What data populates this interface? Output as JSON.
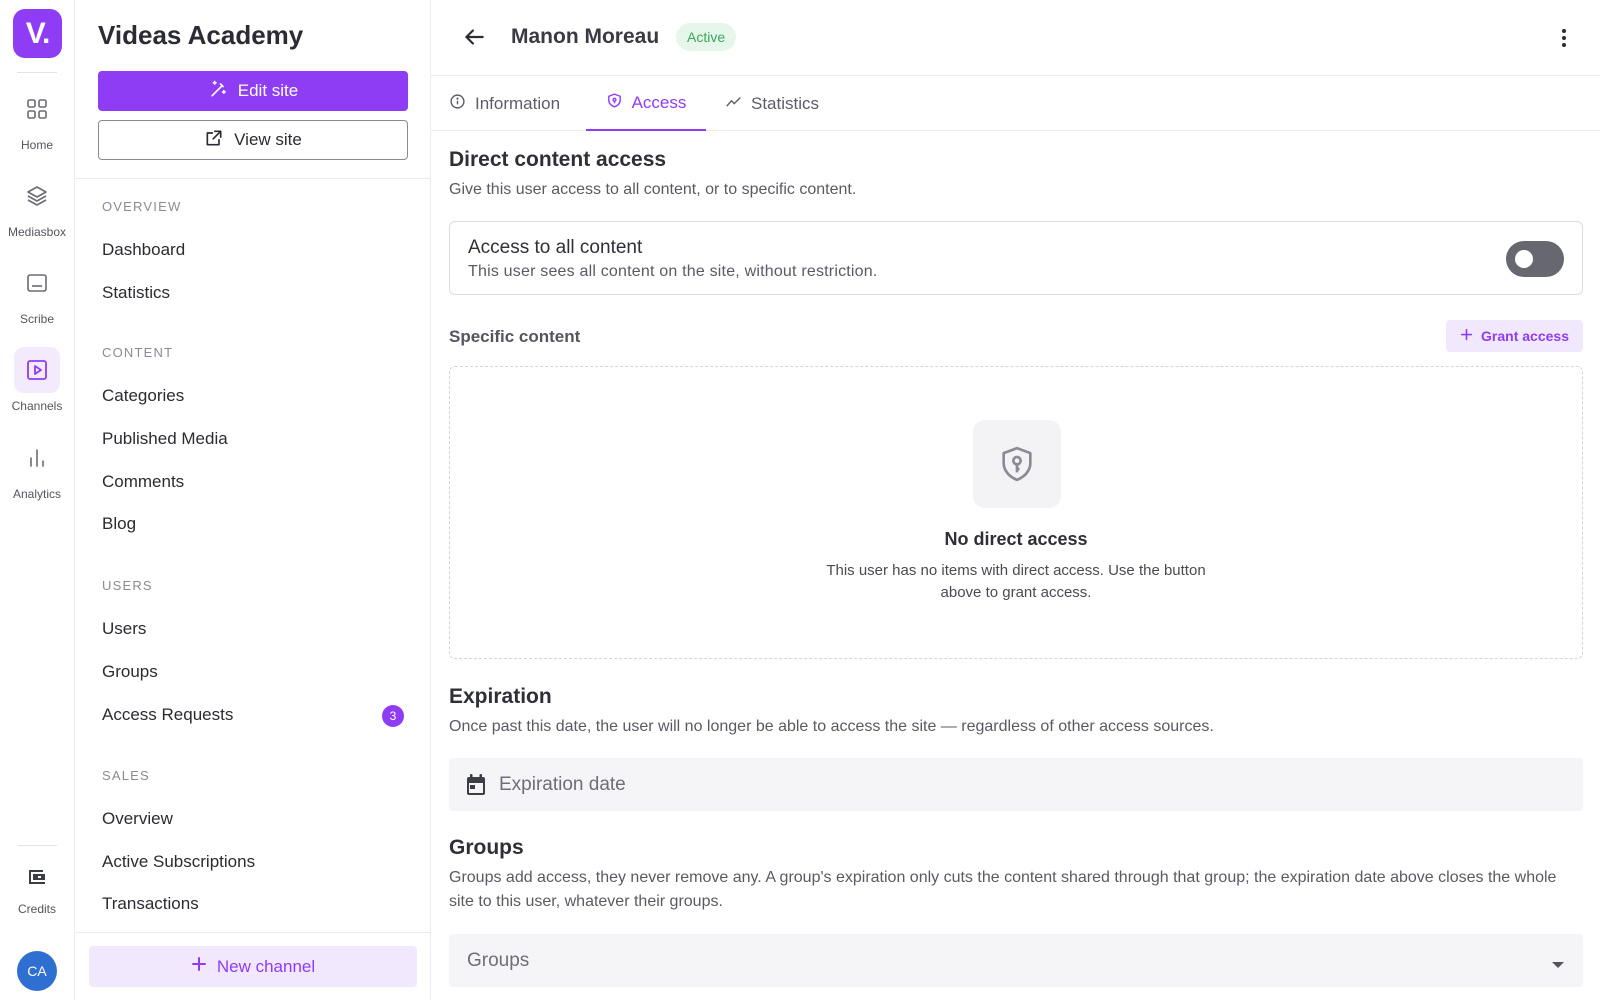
{
  "rail": {
    "logo": "V.",
    "items": [
      {
        "label": "Home",
        "icon": "grid-icon"
      },
      {
        "label": "Mediasbox",
        "icon": "layers-icon"
      },
      {
        "label": "Scribe",
        "icon": "subtitles-icon"
      },
      {
        "label": "Channels",
        "icon": "play-square-icon",
        "active": true
      },
      {
        "label": "Analytics",
        "icon": "bar-chart-icon"
      }
    ],
    "credits_label": "Credits",
    "avatar_initials": "CA"
  },
  "sidebar": {
    "site_name": "Videas Academy",
    "edit_site": "Edit site",
    "view_site": "View site",
    "sections": {
      "overview": "OVERVIEW",
      "content": "CONTENT",
      "users": "USERS",
      "sales": "SALES"
    },
    "items": {
      "dashboard": "Dashboard",
      "statistics": "Statistics",
      "categories": "Categories",
      "published_media": "Published Media",
      "comments": "Comments",
      "blog": "Blog",
      "users": "Users",
      "groups": "Groups",
      "access_requests": "Access Requests",
      "access_requests_count": "3",
      "sales_overview": "Overview",
      "active_subscriptions": "Active Subscriptions",
      "transactions": "Transactions"
    },
    "new_channel": "New channel"
  },
  "header": {
    "user_name": "Manon Moreau",
    "status": "Active"
  },
  "tabs": [
    {
      "label": "Information",
      "icon": "info-icon"
    },
    {
      "label": "Access",
      "icon": "shield-icon",
      "active": true
    },
    {
      "label": "Statistics",
      "icon": "trend-icon"
    }
  ],
  "direct_access": {
    "title": "Direct content access",
    "description": "Give this user access to all content, or to specific content.",
    "all_content_title": "Access to all content",
    "all_content_sub": "This user sees all content on the site, without restriction.",
    "all_content_enabled": false,
    "specific_label": "Specific content",
    "grant_button": "Grant access",
    "empty_title": "No direct access",
    "empty_sub": "This user has no items with direct access. Use the button above to grant access."
  },
  "expiration": {
    "title": "Expiration",
    "description": "Once past this date, the user will no longer be able to access the site — regardless of other access sources.",
    "placeholder": "Expiration date"
  },
  "groups": {
    "title": "Groups",
    "description": "Groups add access, they never remove any. A group's expiration only cuts the content shared through that group; the expiration date above closes the whole site to this user, whatever their groups.",
    "placeholder": "Groups"
  },
  "colors": {
    "accent": "#8f3cf5",
    "accent_light": "#f1e8fd",
    "status_green": "#3aa85b",
    "avatar_blue": "#2f6fd1"
  }
}
